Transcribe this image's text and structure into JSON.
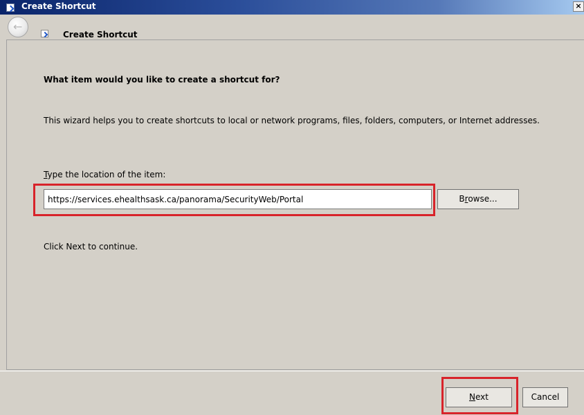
{
  "window": {
    "title": "Create Shortcut",
    "close_label": "×"
  },
  "header": {
    "back_glyph": "←",
    "title": "Create Shortcut"
  },
  "main": {
    "heading": "What item would you like to create a shortcut for?",
    "description": "This wizard helps you to create shortcuts to local or network programs, files, folders, computers, or Internet addresses.",
    "location_label_first": "T",
    "location_label_rest": "ype the location of the item:",
    "location_value": "https://services.ehealthsask.ca/panorama/SecurityWeb/Portal",
    "browse_first": "B",
    "browse_u": "r",
    "browse_rest": "owse...",
    "continue_text": "Click Next to continue."
  },
  "footer": {
    "next_u": "N",
    "next_rest": "ext",
    "cancel_label": "Cancel"
  },
  "colors": {
    "title_bar": "#0a246a",
    "highlight": "#d8232a",
    "dialog_bg": "#d4d0c8"
  },
  "icons": {
    "title": "shortcut-icon",
    "back": "back-arrow-icon",
    "header": "shortcut-icon"
  }
}
